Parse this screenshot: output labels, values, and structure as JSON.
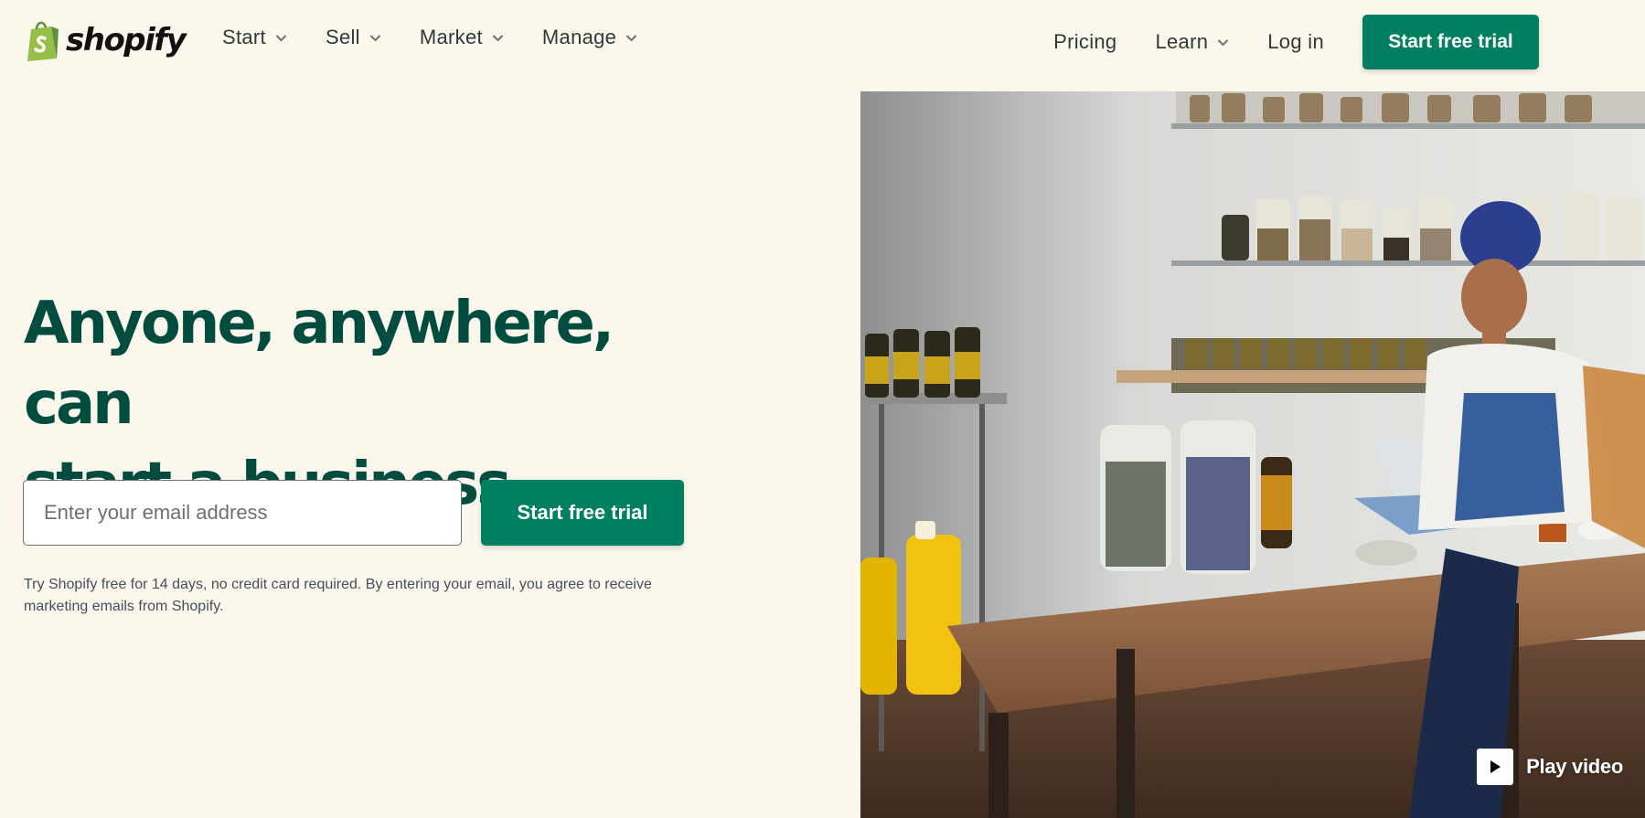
{
  "brand": {
    "name": "shopify",
    "accent": "#008060",
    "heading_color": "#004c3f",
    "background": "#fbf7ed"
  },
  "nav": {
    "left": [
      {
        "label": "Start",
        "icon": "chevron-down-icon"
      },
      {
        "label": "Sell",
        "icon": "chevron-down-icon"
      },
      {
        "label": "Market",
        "icon": "chevron-down-icon"
      },
      {
        "label": "Manage",
        "icon": "chevron-down-icon"
      }
    ],
    "right": {
      "pricing": "Pricing",
      "learn": "Learn",
      "login": "Log in",
      "cta": "Start free trial"
    }
  },
  "hero": {
    "title_line1": "Anyone, anywhere, can",
    "title_line2": "start a business",
    "email_placeholder": "Enter your email address",
    "cta": "Start free trial",
    "disclaimer_line1": "Try Shopify free for 14 days, no credit card required. By entering your email, you agree to receive",
    "disclaimer_line2": "marketing emails from Shopify.",
    "play_video": "Play video",
    "play_icon": "play-icon",
    "image_subject": "hero-photo"
  }
}
